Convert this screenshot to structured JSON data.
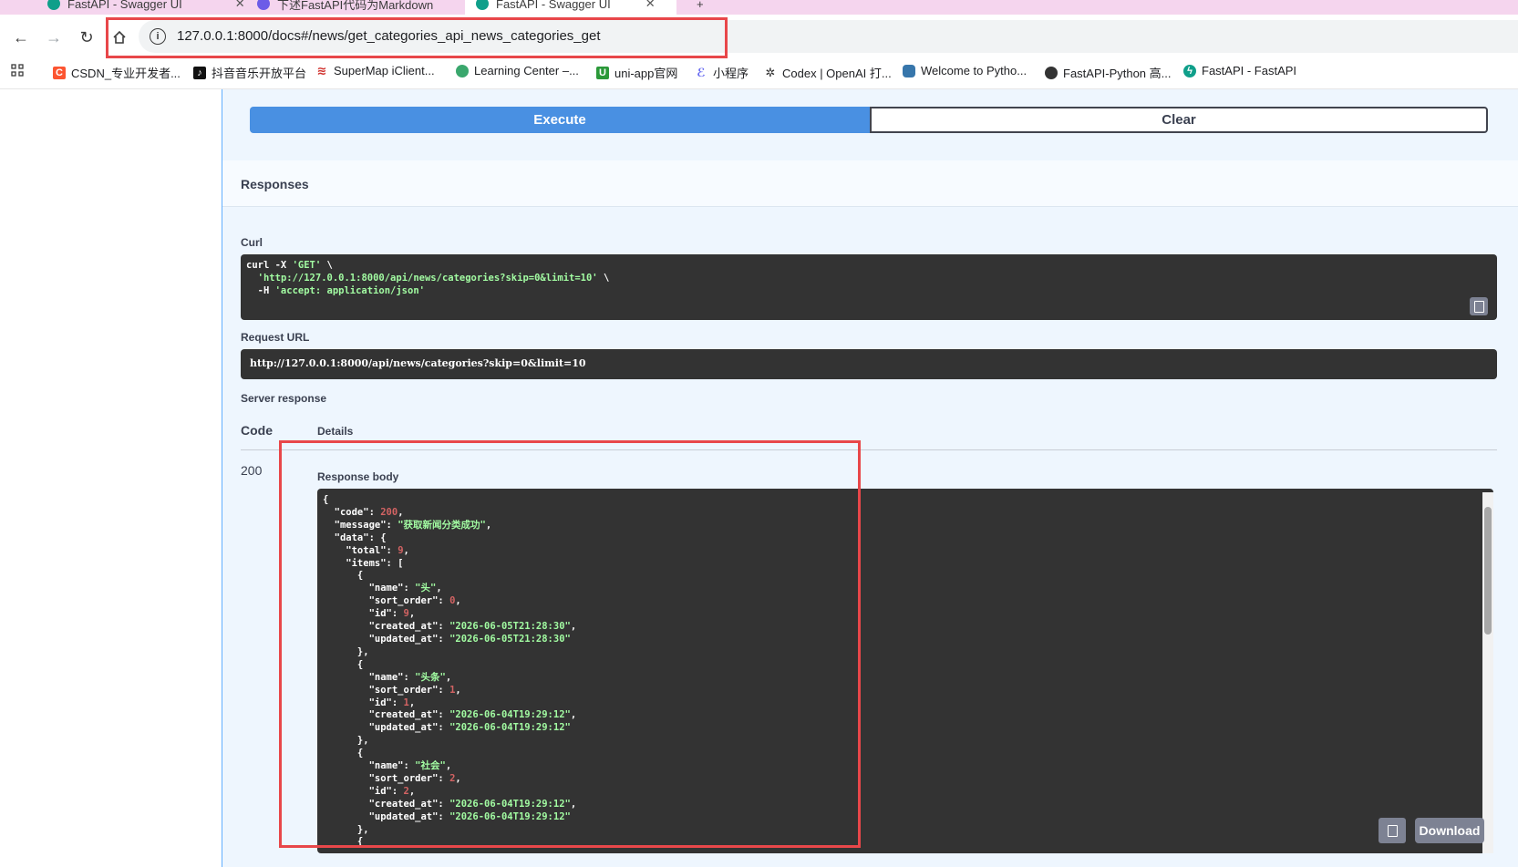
{
  "browser": {
    "tabs": [
      {
        "title": "FastAPI - Swagger UI"
      },
      {
        "title": "下述FastAPI代码为Markdown"
      },
      {
        "title": "FastAPI - Swagger UI"
      }
    ],
    "url": "127.0.0.1:8000/docs#/news/get_categories_api_news_categories_get",
    "bookmarks": [
      "CSDN_专业开发者...",
      "抖音音乐开放平台",
      "SuperMap iClient...",
      "Learning Center –...",
      "uni-app官网",
      "小程序",
      "Codex | OpenAI 打...",
      "Welcome to Pytho...",
      "FastAPI-Python 高...",
      "FastAPI - FastAPI"
    ]
  },
  "swagger": {
    "execute_label": "Execute",
    "clear_label": "Clear",
    "responses_title": "Responses",
    "curl_label": "Curl",
    "curl_lines": [
      "curl -X ",
      "'GET'",
      " \\",
      "  ",
      "'http://127.0.0.1:8000/api/news/categories?skip=0&limit=10'",
      " \\",
      "  -H ",
      "'accept: application/json'"
    ],
    "request_url_label": "Request URL",
    "request_url": "http://127.0.0.1:8000/api/news/categories?skip=0&limit=10",
    "server_response_label": "Server response",
    "code_header": "Code",
    "details_header": "Details",
    "status_code": "200",
    "response_body_label": "Response body",
    "download_label": "Download",
    "response_body": {
      "code": 200,
      "message": "获取新闻分类成功",
      "total": 9,
      "items": [
        {
          "name": "头",
          "sort_order": 0,
          "id": 9,
          "created_at": "2026-06-05T21:28:30",
          "updated_at": "2026-06-05T21:28:30"
        },
        {
          "name": "头条",
          "sort_order": 1,
          "id": 1,
          "created_at": "2026-06-04T19:29:12",
          "updated_at": "2026-06-04T19:29:12"
        },
        {
          "name": "社会",
          "sort_order": 2,
          "id": 2,
          "created_at": "2026-06-04T19:29:12",
          "updated_at": "2026-06-04T19:29:12"
        }
      ]
    }
  },
  "colors": {
    "execute": "#4990e2",
    "highlight": "#e8474a",
    "code_bg": "#333333",
    "string": "#a2fca2",
    "number": "#d36363"
  }
}
